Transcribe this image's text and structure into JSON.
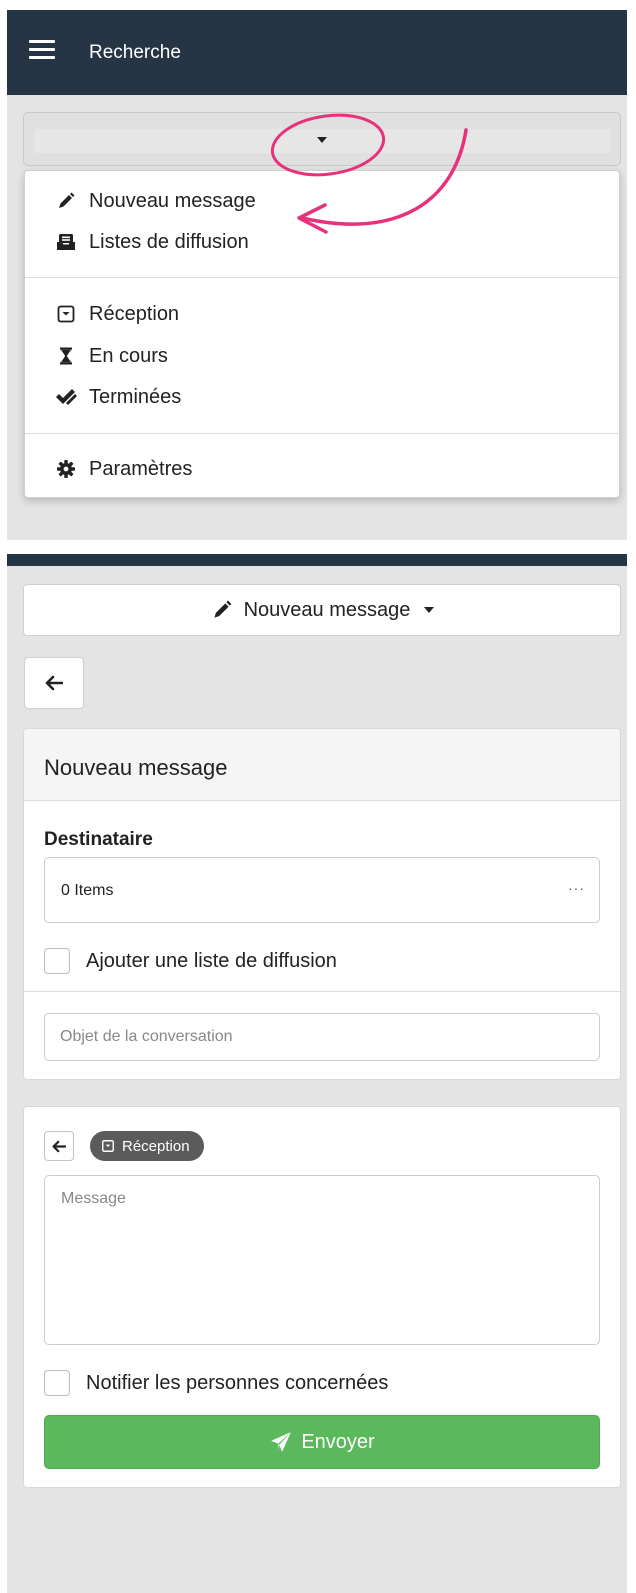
{
  "colors": {
    "topbar": "#263545",
    "success": "#5cb85c",
    "badge": "#5b5b5b",
    "annotation": "#e8317b"
  },
  "panel1": {
    "header": {
      "menu_icon": "hamburger-icon",
      "title": "Recherche"
    },
    "dropdown": {
      "groups": [
        [
          {
            "label": "Nouveau message",
            "icon": "pencil-icon"
          },
          {
            "label": "Listes de diffusion",
            "icon": "mailbox-list-icon"
          }
        ],
        [
          {
            "label": "Réception",
            "icon": "inbox-icon"
          },
          {
            "label": "En cours",
            "icon": "hourglass-icon"
          },
          {
            "label": "Terminées",
            "icon": "double-check-icon"
          }
        ],
        [
          {
            "label": "Paramètres",
            "icon": "gear-icon"
          }
        ]
      ]
    }
  },
  "panel2": {
    "nav_select": {
      "label": "Nouveau message",
      "icon": "pencil-icon"
    },
    "form": {
      "title": "Nouveau message",
      "recipient_label": "Destinataire",
      "recipient_value": "0 Items",
      "recipient_more": "···",
      "add_list_label": "Ajouter une liste de diffusion",
      "subject_placeholder": "Objet de la conversation"
    },
    "message": {
      "badge_label": "Réception",
      "message_placeholder": "Message",
      "notify_label": "Notifier les personnes concernées",
      "send_label": "Envoyer"
    }
  }
}
